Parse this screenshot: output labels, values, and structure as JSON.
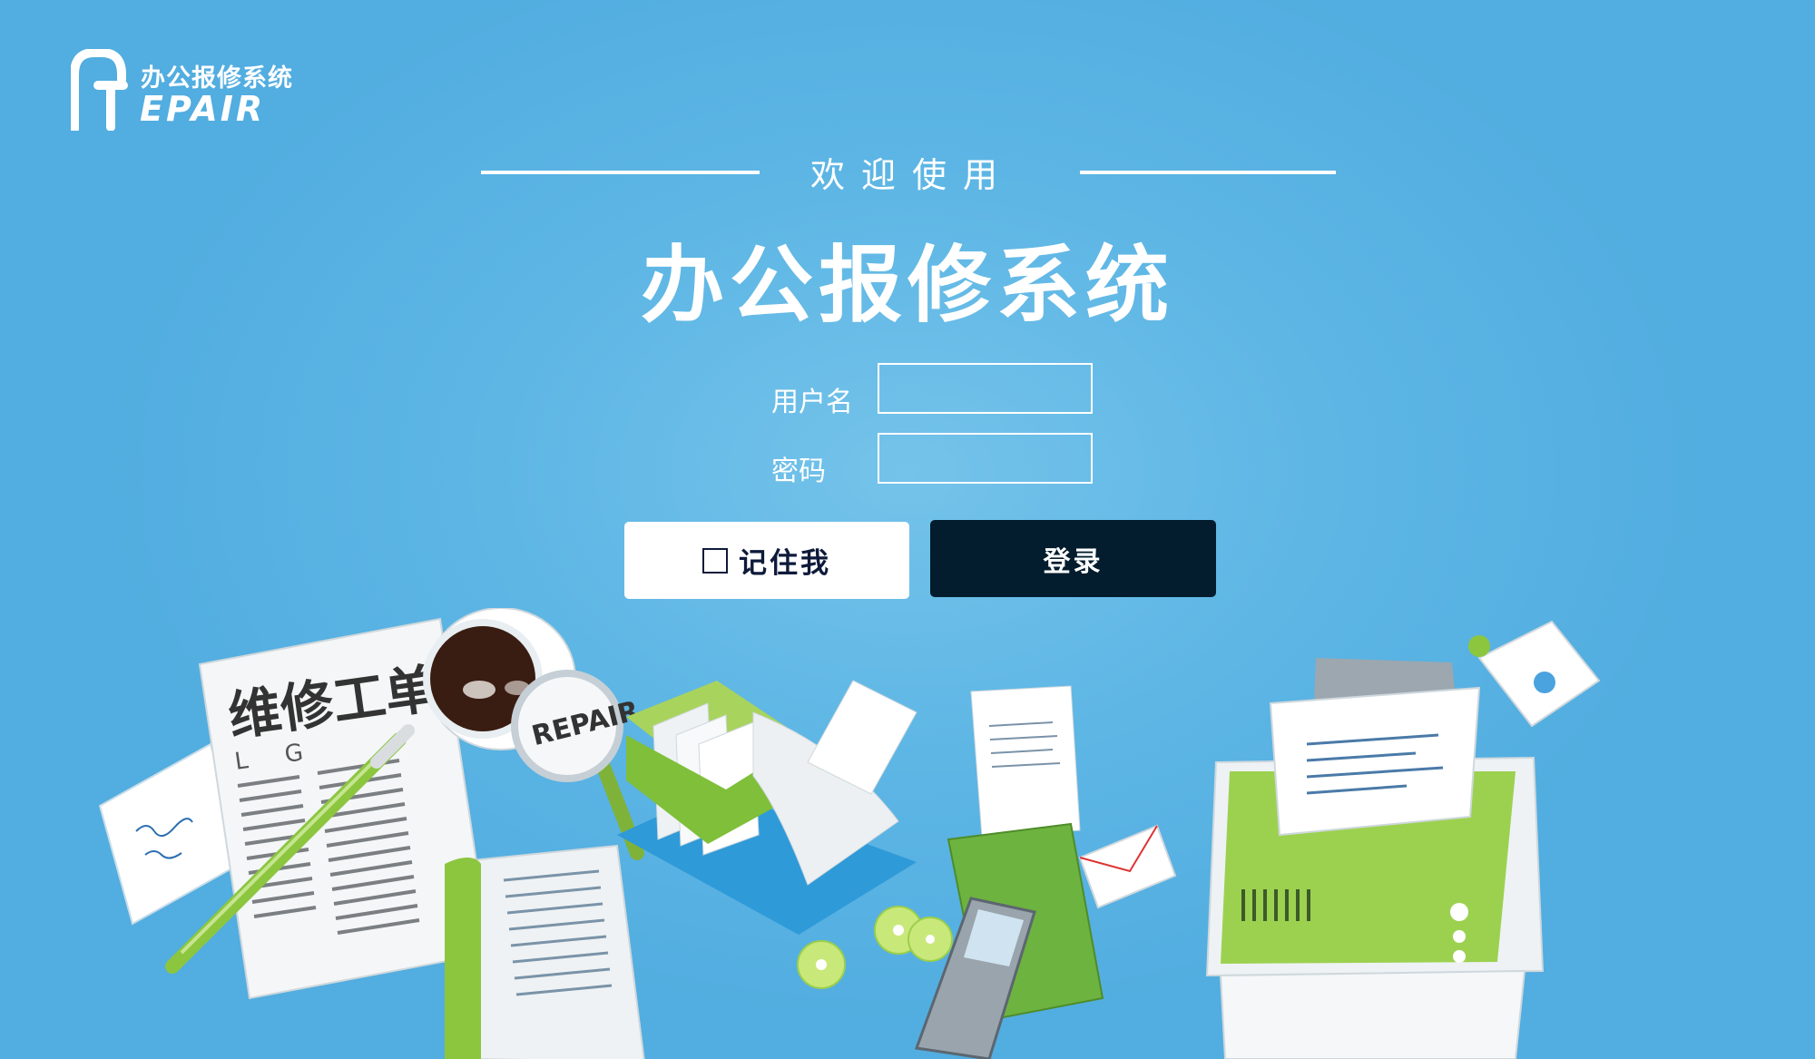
{
  "logo": {
    "chinese": "办公报修系统",
    "english": "EPAIR",
    "icon": "repair-r-logo-icon"
  },
  "header": {
    "welcome": "欢迎使用",
    "title": "办公报修系统"
  },
  "form": {
    "username_label": "用户名",
    "username_value": "",
    "password_label": "密码",
    "password_value": "",
    "remember_label": "记住我",
    "remember_checked": false,
    "login_label": "登录"
  },
  "illustration": {
    "newspaper_headline": "维修工单",
    "newspaper_initials": [
      "L",
      "G"
    ],
    "magnifier_text": "REPAIR"
  },
  "colors": {
    "background": "#5cb5e4",
    "login_button": "#031d2e",
    "accent_green": "#8cc63f"
  }
}
